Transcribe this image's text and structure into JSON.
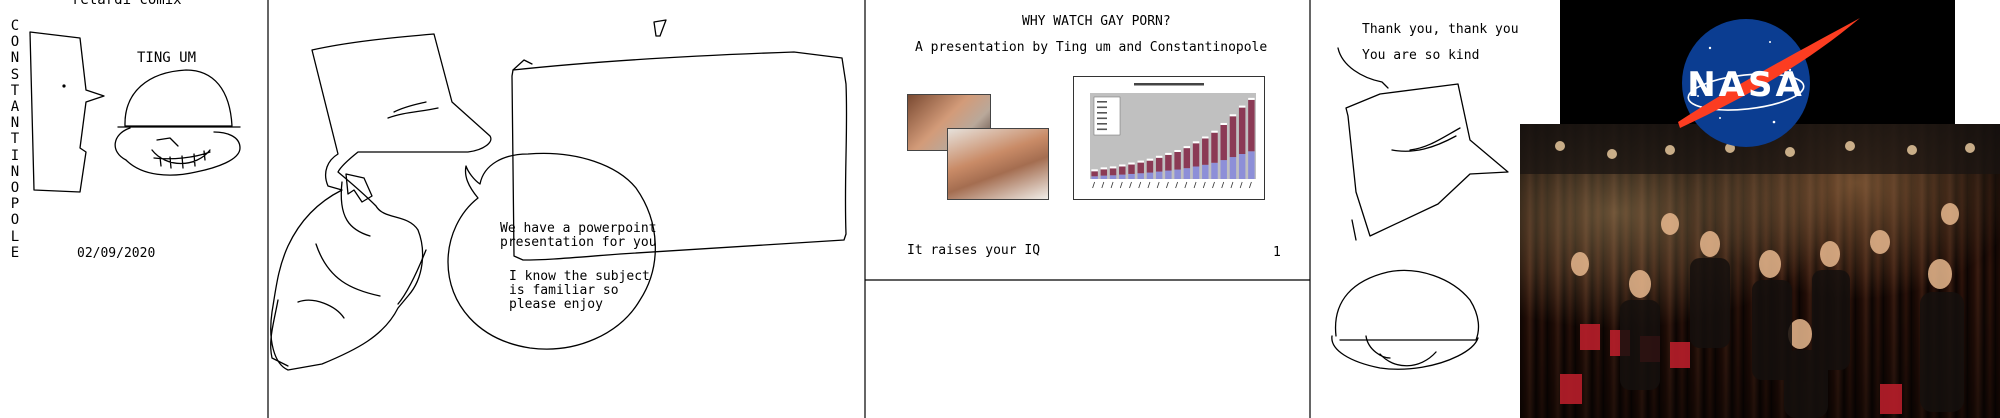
{
  "panel1": {
    "title": "retardi comix",
    "vertical_name": "CONSTANTINOPOLE",
    "character_label": "TING UM",
    "date": "02/09/2020"
  },
  "panel2": {
    "speech_line1": "We have a powerpoint",
    "speech_line2": "presentation for you",
    "speech_line3": "I know the subject",
    "speech_line4": "is familiar so",
    "speech_line5": "please enjoy"
  },
  "slide": {
    "title": "WHY WATCH GAY PORN?",
    "subtitle": "A presentation by Ting um and Constantinopole",
    "caption": "It raises your IQ",
    "page_number": "1"
  },
  "panel4": {
    "speech_line1": "Thank you, thank you",
    "speech_line2": "You are so kind"
  },
  "nasa": {
    "logo_text": "NASA",
    "colors": {
      "blue": "#0b3d91",
      "red": "#fc3d21",
      "white": "#ffffff"
    }
  },
  "chart_data": {
    "type": "bar",
    "title": "",
    "values": [
      8,
      10,
      11,
      13,
      15,
      17,
      19,
      22,
      25,
      28,
      32,
      37,
      42,
      48,
      56,
      65,
      74,
      82
    ],
    "colors": {
      "bars": "#8b3a55",
      "base": "#8d8fd8",
      "background": "#c0c0c0"
    }
  },
  "icons": [
    "bar-chart-thumbnail",
    "photo-thumbnail",
    "nasa-logo",
    "audience-photo"
  ]
}
